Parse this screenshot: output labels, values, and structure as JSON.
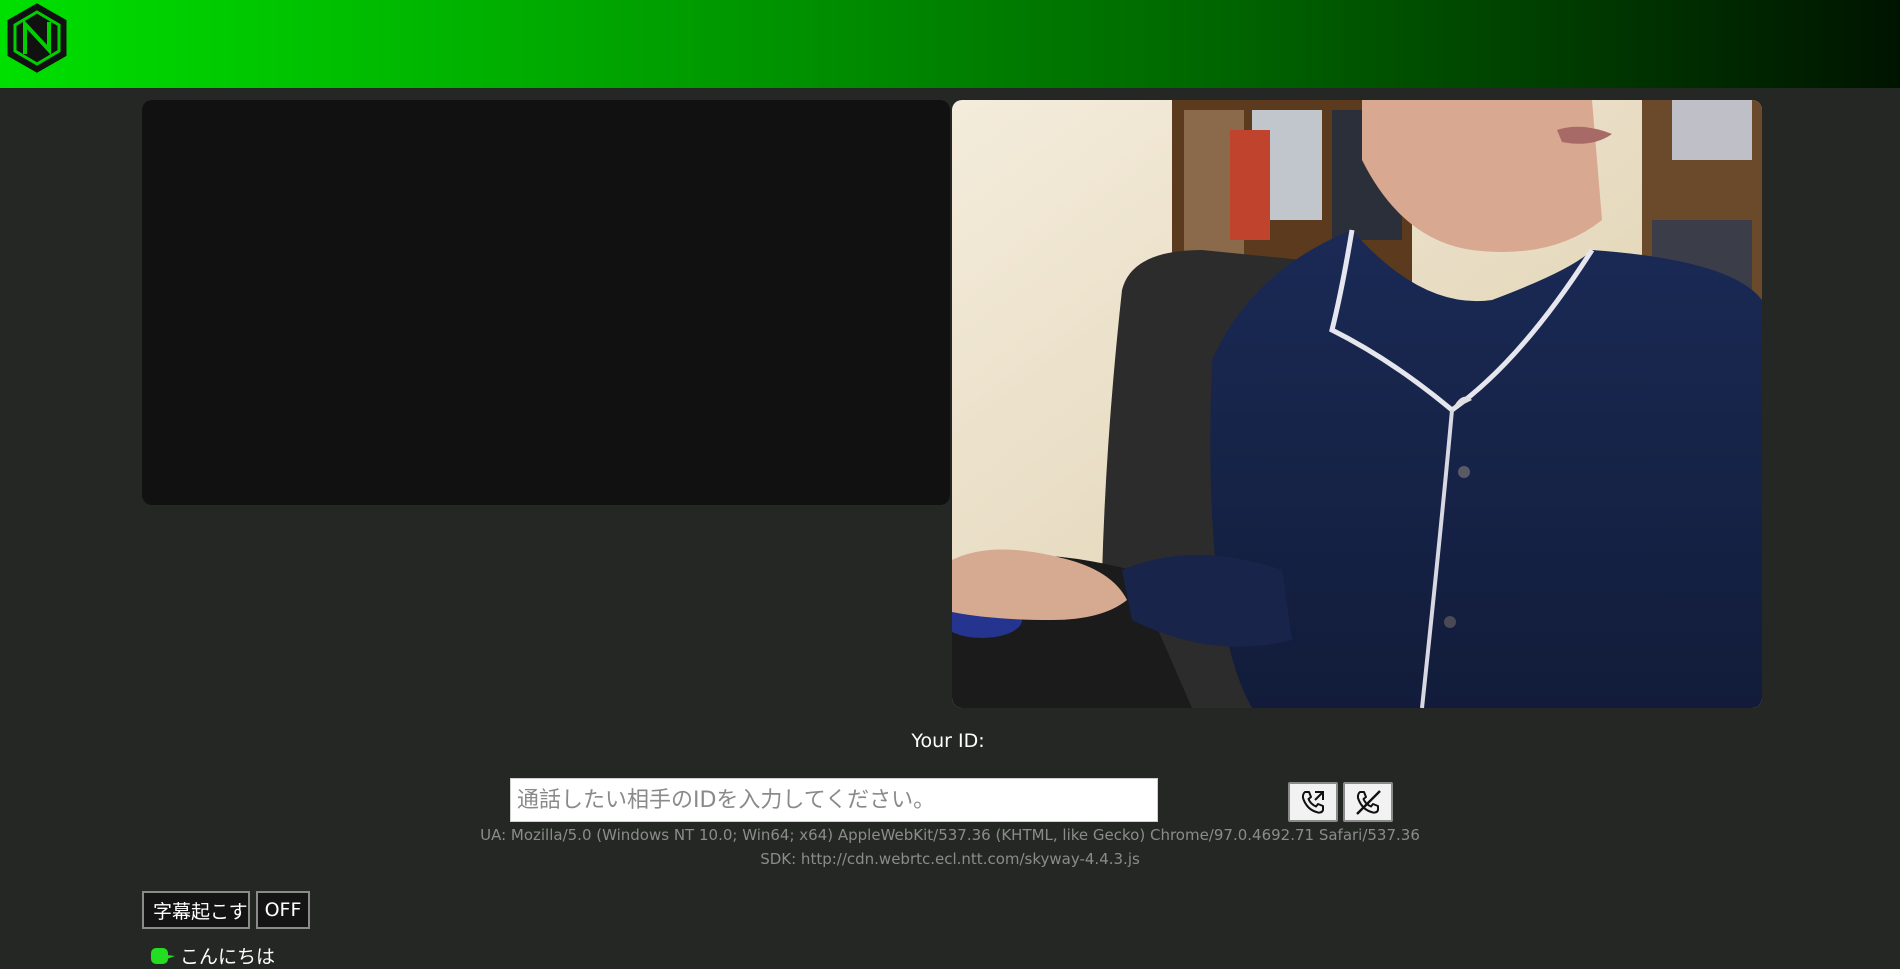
{
  "header": {
    "logo_icon": "hexagon-n-logo-icon",
    "gradient_colors": [
      "#00e000",
      "#006400",
      "#001400"
    ]
  },
  "remote_video": {
    "background": "#111111"
  },
  "local_video": {
    "content": "webcam-feed"
  },
  "call": {
    "your_id_label": "Your ID:",
    "your_id_value": "",
    "peer_input_placeholder": "通話したい相手のIDを入力してください。",
    "peer_input_value": "",
    "call_icon": "phone-call-icon",
    "hangup_icon": "phone-hangup-icon"
  },
  "info": {
    "ua": "UA: Mozilla/5.0 (Windows NT 10.0; Win64; x64) AppleWebKit/537.36 (KHTML, like Gecko) Chrome/97.0.4692.71 Safari/537.36",
    "sdk": "SDK: http://cdn.webrtc.ecl.ntt.com/skyway-4.4.3.js"
  },
  "transcription": {
    "start_label": "字幕起こす",
    "toggle_label": "OFF",
    "caption_icon": "speech-bubble-icon",
    "caption_text": "こんにちは",
    "accent_color": "#22dd22"
  }
}
